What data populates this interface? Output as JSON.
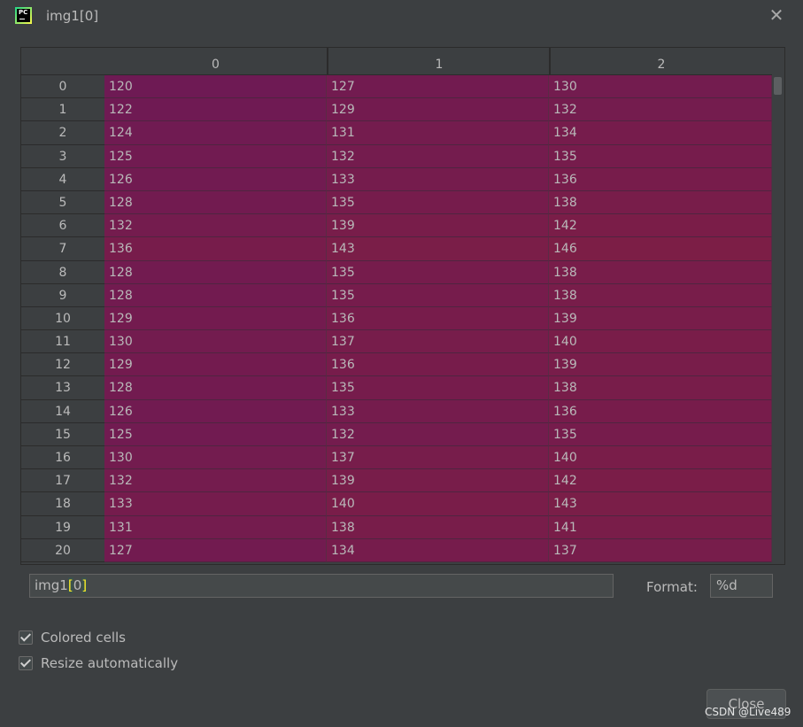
{
  "window": {
    "title": "img1[0]"
  },
  "table": {
    "columns": [
      "0",
      "1",
      "2"
    ],
    "rows": [
      {
        "index": "0",
        "values": [
          "120",
          "127",
          "130"
        ]
      },
      {
        "index": "1",
        "values": [
          "122",
          "129",
          "132"
        ]
      },
      {
        "index": "2",
        "values": [
          "124",
          "131",
          "134"
        ]
      },
      {
        "index": "3",
        "values": [
          "125",
          "132",
          "135"
        ]
      },
      {
        "index": "4",
        "values": [
          "126",
          "133",
          "136"
        ]
      },
      {
        "index": "5",
        "values": [
          "128",
          "135",
          "138"
        ]
      },
      {
        "index": "6",
        "values": [
          "132",
          "139",
          "142"
        ]
      },
      {
        "index": "7",
        "values": [
          "136",
          "143",
          "146"
        ]
      },
      {
        "index": "8",
        "values": [
          "128",
          "135",
          "138"
        ]
      },
      {
        "index": "9",
        "values": [
          "128",
          "135",
          "138"
        ]
      },
      {
        "index": "10",
        "values": [
          "129",
          "136",
          "139"
        ]
      },
      {
        "index": "11",
        "values": [
          "130",
          "137",
          "140"
        ]
      },
      {
        "index": "12",
        "values": [
          "129",
          "136",
          "139"
        ]
      },
      {
        "index": "13",
        "values": [
          "128",
          "135",
          "138"
        ]
      },
      {
        "index": "14",
        "values": [
          "126",
          "133",
          "136"
        ]
      },
      {
        "index": "15",
        "values": [
          "125",
          "132",
          "135"
        ]
      },
      {
        "index": "16",
        "values": [
          "130",
          "137",
          "140"
        ]
      },
      {
        "index": "17",
        "values": [
          "132",
          "139",
          "142"
        ]
      },
      {
        "index": "18",
        "values": [
          "133",
          "140",
          "143"
        ]
      },
      {
        "index": "19",
        "values": [
          "131",
          "138",
          "141"
        ]
      },
      {
        "index": "20",
        "values": [
          "127",
          "134",
          "137"
        ]
      }
    ]
  },
  "expression": {
    "prefix": "img1",
    "open": "[",
    "index": "0",
    "close": "]"
  },
  "format": {
    "label": "Format:",
    "value": "%d"
  },
  "options": {
    "colored_cells": {
      "label": "Colored cells",
      "checked": true
    },
    "resize_automatically": {
      "label": "Resize automatically",
      "checked": true
    }
  },
  "buttons": {
    "close_label": "Close"
  },
  "watermark": "CSDN @Live489",
  "colors": {
    "background": "#3c3f41",
    "cell_low": "#6e1a54",
    "cell_high": "#7c1e46"
  }
}
